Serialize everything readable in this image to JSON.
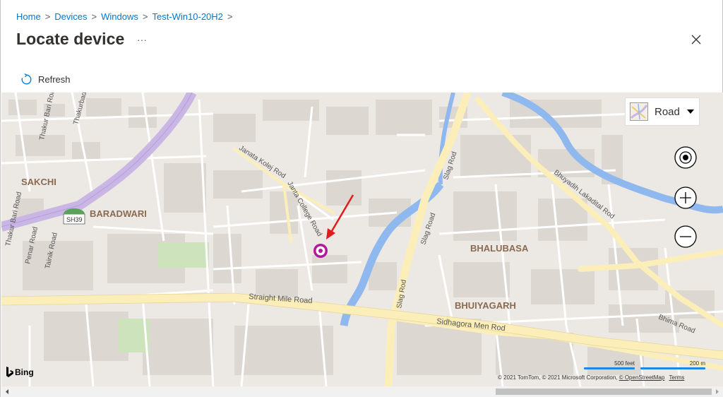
{
  "breadcrumb": [
    {
      "label": "Home"
    },
    {
      "label": "Devices"
    },
    {
      "label": "Windows"
    },
    {
      "label": "Test-Win10-20H2"
    }
  ],
  "breadcrumb_separator": ">",
  "page": {
    "title": "Locate device",
    "more_label": "···"
  },
  "toolbar": {
    "refresh_label": "Refresh"
  },
  "map": {
    "map_type_label": "Road",
    "provider_label": "Bing",
    "scale_feet": "500 feet",
    "scale_meters": "200 m",
    "attribution": {
      "text": "© 2021 TomTom, © 2021 Microsoft Corporation, ",
      "osm_link": "© OpenStreetMap",
      "terms_link": "Terms"
    },
    "labels": [
      {
        "text": "SAKCHI"
      },
      {
        "text": "BARADWARI"
      },
      {
        "text": "BHALUBASA"
      },
      {
        "text": "BHUIYAGARH"
      },
      {
        "text": "SH39"
      },
      {
        "text": "Thakur Bari Road"
      },
      {
        "text": "Thakurbad"
      },
      {
        "text": "Thakur Bari Road"
      },
      {
        "text": "Penar Road"
      },
      {
        "text": "Tainik Road"
      },
      {
        "text": "Janata Kolej Rod"
      },
      {
        "text": "Janta College Road"
      },
      {
        "text": "Slag Rod"
      },
      {
        "text": "Slag Road"
      },
      {
        "text": "Slag Rod"
      },
      {
        "text": "Straight Mile Road"
      },
      {
        "text": "Sidhagora Men Rod"
      },
      {
        "text": "Bhuyadih Lakadital Rod"
      },
      {
        "text": "Bhima Road"
      }
    ],
    "colors": {
      "background": "#ece9e4",
      "major_road": "#fbeeb8",
      "highway": "#c9b6e4",
      "river": "#8fb8ee",
      "pin": "#b3179b",
      "arrow": "#e21b1b"
    }
  }
}
